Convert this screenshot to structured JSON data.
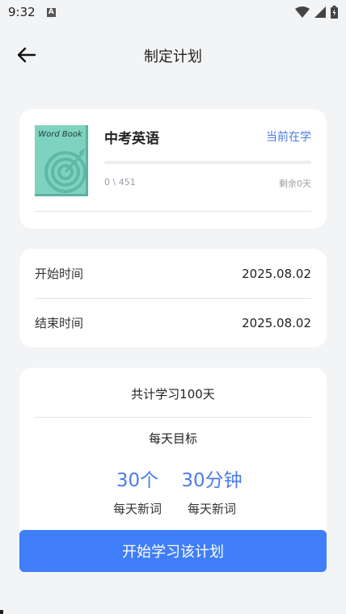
{
  "status_bar": {
    "time": "9:32",
    "a_icon": "A"
  },
  "header": {
    "title": "制定计划"
  },
  "book": {
    "cover_title": "Word Book",
    "name": "中考英语",
    "current_tag": "当前在学",
    "progress_text": "0 \\ 451",
    "progress_fraction": 0,
    "remaining": "剩余0天"
  },
  "dates": {
    "start_label": "开始时间",
    "start_value": "2025.08.02",
    "end_label": "结束时间",
    "end_value": "2025.08.02"
  },
  "summary": {
    "total_days": "共计学习100天",
    "daily_goal_label": "每天目标",
    "goals": [
      {
        "value": "30个",
        "label": "每天新词"
      },
      {
        "value": "30分钟",
        "label": "每天新词"
      }
    ]
  },
  "start_button_label": "开始学习该计划",
  "colors": {
    "accent": "#3f7ef6",
    "cover": "#7fd2bf",
    "background": "#f3f4f6"
  }
}
